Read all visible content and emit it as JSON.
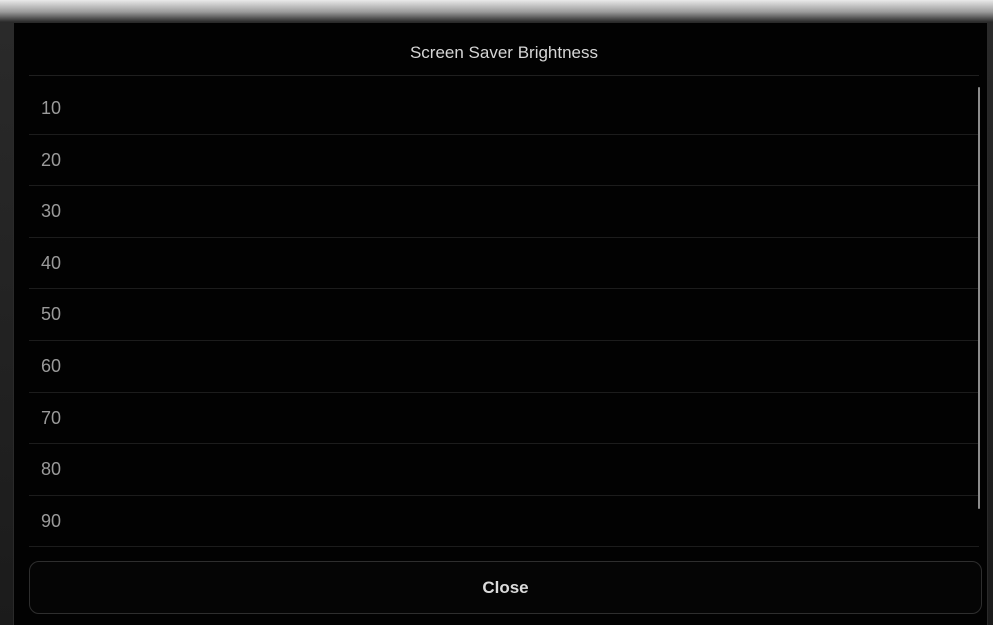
{
  "dialog": {
    "title": "Screen Saver Brightness",
    "options": [
      "10",
      "20",
      "30",
      "40",
      "50",
      "60",
      "70",
      "80",
      "90"
    ],
    "close_label": "Close"
  }
}
